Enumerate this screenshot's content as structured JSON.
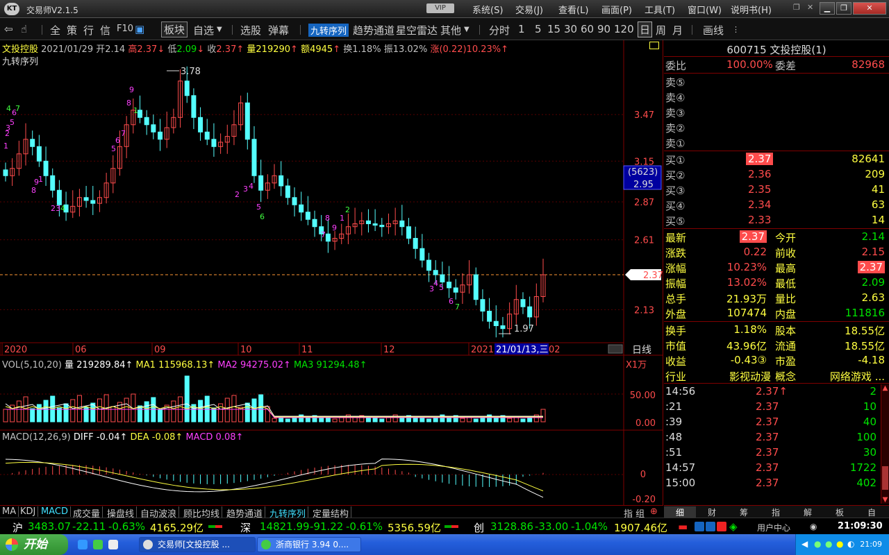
{
  "window": {
    "logo": "KT",
    "title": "交易师V2.1.5",
    "vip": "VIP",
    "menus": [
      "系统(S)",
      "交易(J)",
      "查看(L)",
      "画面(P)",
      "工具(T)",
      "窗口(W)",
      "说明书(H)"
    ]
  },
  "toolbar": {
    "items": [
      "全",
      "策",
      "行",
      "信",
      "F10",
      "板块",
      "自选",
      "选股",
      "弹幕",
      "九转序列",
      "趋势通道",
      "星空雷达",
      "其他",
      "分时",
      "1",
      "5",
      "15",
      "30",
      "60",
      "90",
      "120",
      "日",
      "周",
      "月",
      "画线"
    ]
  },
  "info": {
    "name": "文投控股",
    "date": "2021/01/29",
    "open_label": "开",
    "open": "2.14",
    "high_label": "高",
    "high": "2.37",
    "low_label": "低",
    "low": "2.09",
    "close_label": "收",
    "close": "2.37",
    "vol_label": "量",
    "vol": "219290",
    "amt_label": "额",
    "amt": "4945",
    "turn_label": "换",
    "turn": "1.18%",
    "amp_label": "振",
    "amp": "13.02%",
    "chg_label": "涨",
    "chg": "(0.22)10.23%",
    "indicator": "九转序列"
  },
  "price_chart": {
    "y_ticks": [
      "3.47",
      "3.15",
      "2.87",
      "2.61",
      "2.13"
    ],
    "current_price": "2.37",
    "tag_top": "(5623)",
    "tag_bottom": "2.95",
    "max_label": "3.78",
    "min_label": "1.97",
    "x_ticks": [
      "2020",
      "06",
      "09",
      "10",
      "11",
      "12",
      "2021"
    ],
    "cursor_date": "21/01/13,三",
    "x_tail": "02",
    "period": "日线"
  },
  "chart_data": [
    {
      "type": "candlestick",
      "title": "文投控股 日线 九转序列",
      "y_ticks": [
        3.47,
        3.15,
        2.87,
        2.61,
        2.13
      ],
      "close": [
        3.05,
        3.1,
        3.2,
        3.3,
        3.25,
        3.15,
        3.05,
        2.95,
        2.85,
        2.8,
        2.84,
        2.9,
        2.88,
        2.86,
        2.9,
        3.0,
        3.1,
        3.25,
        3.4,
        3.5,
        3.45,
        3.4,
        3.35,
        3.3,
        3.38,
        3.45,
        3.7,
        3.6,
        3.45,
        3.35,
        3.3,
        3.25,
        3.28,
        3.32,
        3.4,
        3.55,
        3.3,
        3.05,
        2.95,
        3.0,
        3.05,
        2.98,
        2.9,
        2.85,
        2.8,
        2.75,
        2.7,
        2.65,
        2.6,
        2.62,
        2.65,
        2.7,
        2.72,
        2.74,
        2.72,
        2.71,
        2.7,
        2.72,
        2.74,
        2.7,
        2.62,
        2.55,
        2.47,
        2.4,
        2.37,
        2.32,
        2.28,
        2.25,
        2.3,
        2.37,
        2.2,
        2.12,
        2.05,
        2.02,
        2.0,
        2.1,
        2.2,
        2.15,
        2.08,
        2.22,
        2.37
      ],
      "max_label": 3.78,
      "min_label": 1.97,
      "current": 2.37
    },
    {
      "type": "bar",
      "title": "VOL(5,10,20)",
      "series": [
        {
          "name": "量",
          "last": "219289.84"
        },
        {
          "name": "MA1",
          "last": "115968.13"
        },
        {
          "name": "MA2",
          "last": "94275.02"
        },
        {
          "name": "MA3",
          "last": "91294.48"
        }
      ],
      "y_ticks": [
        50.0,
        0.0
      ],
      "unit": "X1万"
    },
    {
      "type": "line",
      "title": "MACD(12,26,9)",
      "series": [
        {
          "name": "DIFF",
          "last": "-0.04"
        },
        {
          "name": "DEA",
          "last": "-0.08"
        },
        {
          "name": "MACD",
          "last": "0.08"
        }
      ],
      "y_ticks": [
        0,
        -0.2
      ]
    }
  ],
  "vol_header": {
    "title": "VOL(5,10,20)",
    "vol_label": "量",
    "vol": "219289.84↑",
    "ma1_label": "MA1",
    "ma1": "115968.13↑",
    "ma2_label": "MA2",
    "ma2": "94275.02↑",
    "ma3_label": "MA3",
    "ma3": "91294.48↑",
    "unit": "X1万",
    "tick_top": "50.00",
    "tick_bottom": "0.00"
  },
  "macd_header": {
    "title": "MACD(12,26,9)",
    "diff_label": "DIFF",
    "diff": "-0.04↑",
    "dea_label": "DEA",
    "dea": "-0.08↑",
    "macd_label": "MACD",
    "macd": "0.08↑",
    "tick_top": "0",
    "tick_bottom": "-0.20"
  },
  "indicator_tabs": [
    "MA",
    "KDJ",
    "MACD",
    "成交量",
    "操盘线",
    "自动波浪",
    "顾比均线",
    "趋势通道",
    "九转序列",
    "定量结构"
  ],
  "indicator_tabs_right": "指 组",
  "quote": {
    "header": "600715 文投控股(1)",
    "weibi_label": "委比",
    "weibi": "100.00%",
    "weicha_label": "委差",
    "weicha": "82968",
    "sells": [
      "卖⑤",
      "卖④",
      "卖③",
      "卖②",
      "卖①"
    ],
    "buys": [
      {
        "label": "买①",
        "price": "2.37",
        "vol": "82641"
      },
      {
        "label": "买②",
        "price": "2.36",
        "vol": "209"
      },
      {
        "label": "买③",
        "price": "2.35",
        "vol": "41"
      },
      {
        "label": "买④",
        "price": "2.34",
        "vol": "63"
      },
      {
        "label": "买⑤",
        "price": "2.33",
        "vol": "14"
      }
    ],
    "stats": [
      {
        "l1": "最新",
        "v1": "2.37",
        "l2": "今开",
        "v2": "2.14"
      },
      {
        "l1": "涨跌",
        "v1": "0.22",
        "l2": "前收",
        "v2": "2.15"
      },
      {
        "l1": "涨幅",
        "v1": "10.23%",
        "l2": "最高",
        "v2": "2.37"
      },
      {
        "l1": "振幅",
        "v1": "13.02%",
        "l2": "最低",
        "v2": "2.09"
      },
      {
        "l1": "总手",
        "v1": "21.93万",
        "l2": "量比",
        "v2": "2.63"
      },
      {
        "l1": "外盘",
        "v1": "107474",
        "l2": "内盘",
        "v2": "111816"
      }
    ],
    "fund": [
      {
        "l1": "换手",
        "v1": "1.18%",
        "l2": "股本",
        "v2": "18.55亿"
      },
      {
        "l1": "市值",
        "v1": "43.96亿",
        "l2": "流通",
        "v2": "18.55亿"
      },
      {
        "l1": "收益",
        "v1": "-0.43③",
        "l2": "市盈",
        "v2": "-4.18"
      },
      {
        "l1": "行业",
        "v1": "影视动漫",
        "l2": "概念",
        "v2": "网络游戏 ..."
      }
    ],
    "ticks": [
      {
        "t": "14:56",
        "p": "2.37↑",
        "v": "2"
      },
      {
        "t": ":21",
        "p": "2.37",
        "v": "10"
      },
      {
        "t": ":39",
        "p": "2.37",
        "v": "40"
      },
      {
        "t": ":48",
        "p": "2.37",
        "v": "100"
      },
      {
        "t": ":51",
        "p": "2.37",
        "v": "30"
      },
      {
        "t": "14:57",
        "p": "2.37",
        "v": "1722"
      },
      {
        "t": "15:00",
        "p": "2.37",
        "v": "402"
      }
    ],
    "tabs": [
      "细",
      "财",
      "筹",
      "指",
      "解",
      "板",
      "自"
    ]
  },
  "status": {
    "sh_label": "沪",
    "sh_idx": "3483.07",
    "sh_chg": "-22.11",
    "sh_pct": "-0.63%",
    "sh_amt": "4165.29亿",
    "sz_label": "深",
    "sz_idx": "14821.99",
    "sz_chg": "-91.22",
    "sz_pct": "-0.61%",
    "sz_amt": "5356.59亿",
    "cy_label": "创",
    "cy_idx": "3128.86",
    "cy_chg": "-33.00",
    "cy_pct": "-1.04%",
    "cy_amt": "1907.46亿",
    "user_center": "用户中心",
    "clock": "21:09:30"
  },
  "taskbar": {
    "start": "开始",
    "btn1": "交易师[文投控股 ...",
    "btn2": "浙商银行 3.94 0....",
    "time": "21:09"
  }
}
